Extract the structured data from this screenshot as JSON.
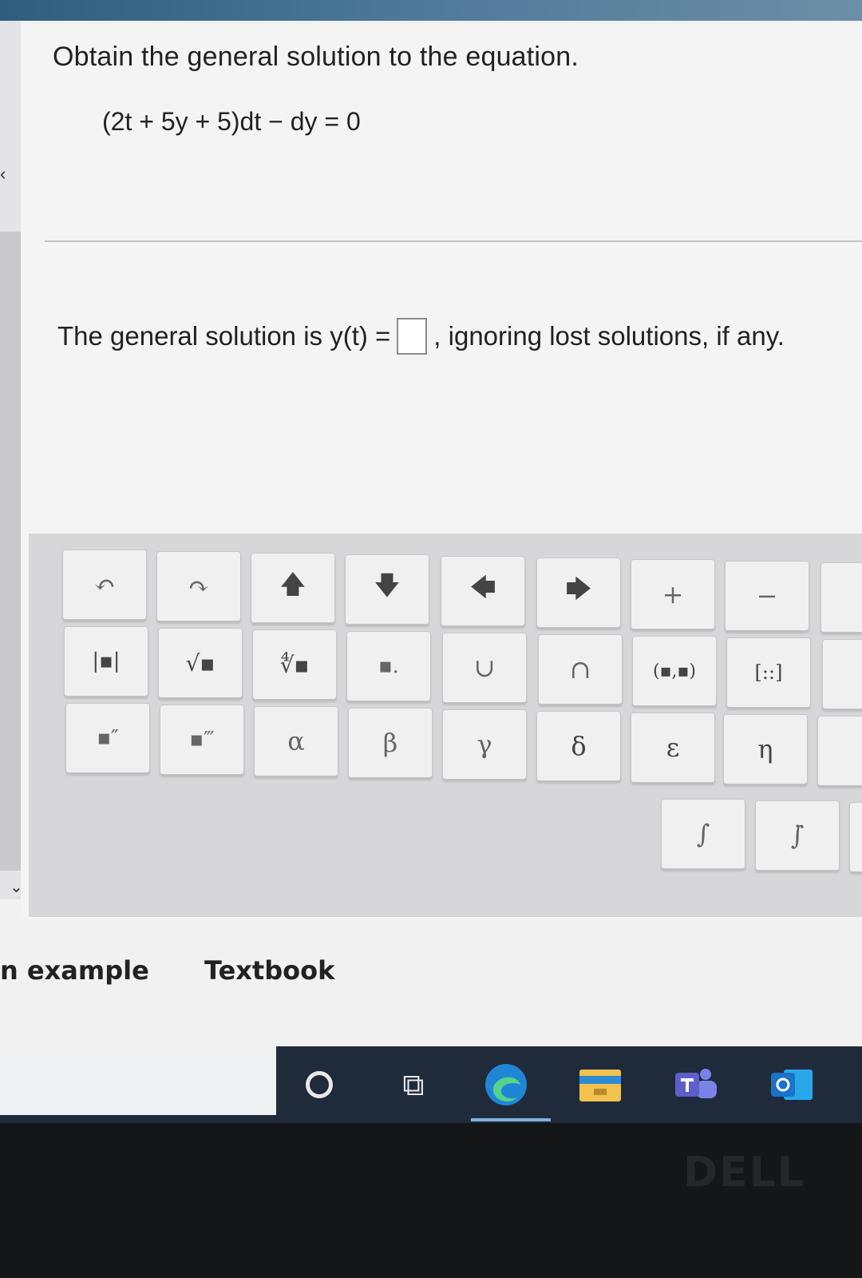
{
  "question": {
    "prompt": "Obtain the general solution to the equation.",
    "equation": "(2t + 5y + 5)dt − dy = 0"
  },
  "answer": {
    "prefix": "The general solution is y(t) =",
    "suffix": ", ignoring lost solutions, if any."
  },
  "palette": {
    "row1": [
      "↶",
      "↷",
      "🡅",
      "🡇",
      "🡄",
      "🡆",
      "+",
      "−"
    ],
    "row2": [
      "|▪|",
      "√▪",
      "∜▪",
      "▪.",
      "∪",
      "∩",
      "(▪,▪)",
      "[::]"
    ],
    "row3": [
      "▪″",
      "▪‴",
      "α",
      "β",
      "γ",
      "δ",
      "ε",
      "η"
    ],
    "row4": [
      "∫",
      "∫̇"
    ]
  },
  "tabs": {
    "example": "n example",
    "textbook": "Textbook"
  },
  "brand": {
    "monitor": "DELL"
  },
  "icons": {
    "nav_left": "chevron-left-icon",
    "nav_down": "chevron-down-icon",
    "cortana": "cortana-circle-icon",
    "task_view": "task-view-icon",
    "edge": "edge-browser-icon",
    "file_explorer": "file-explorer-icon",
    "teams": "teams-icon",
    "outlook": "outlook-icon"
  },
  "colors": {
    "taskbar": "#1f2a3b",
    "edge_blue": "#1f86d6",
    "teams_purple": "#5b5fc7",
    "outlook_blue": "#1a72c9",
    "folder_yellow": "#f2c14e"
  }
}
